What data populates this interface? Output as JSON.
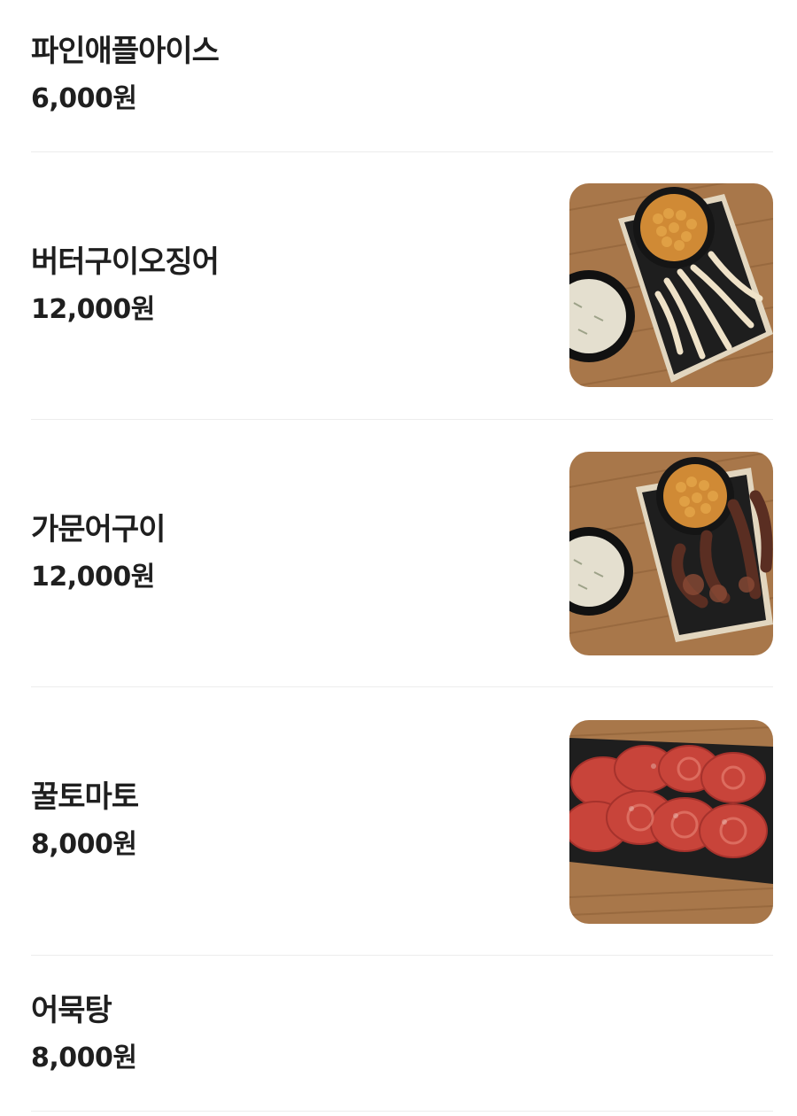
{
  "menu": {
    "items": [
      {
        "name": "파인애플아이스",
        "price": "6,000원",
        "has_photo": false
      },
      {
        "name": "버터구이오징어",
        "price": "12,000원",
        "has_photo": true,
        "photo": "butter-grilled-squid-photo"
      },
      {
        "name": "가문어구이",
        "price": "12,000원",
        "has_photo": true,
        "photo": "grilled-octopus-photo"
      },
      {
        "name": "꿀토마토",
        "price": "8,000원",
        "has_photo": true,
        "photo": "honey-tomato-photo"
      },
      {
        "name": "어묵탕",
        "price": "8,000원",
        "has_photo": false
      }
    ]
  },
  "colors": {
    "text": "#1f1f1f",
    "divider": "#ececec",
    "background": "#ffffff",
    "wood": "#a8774a",
    "plate": "#1e1e1e"
  }
}
